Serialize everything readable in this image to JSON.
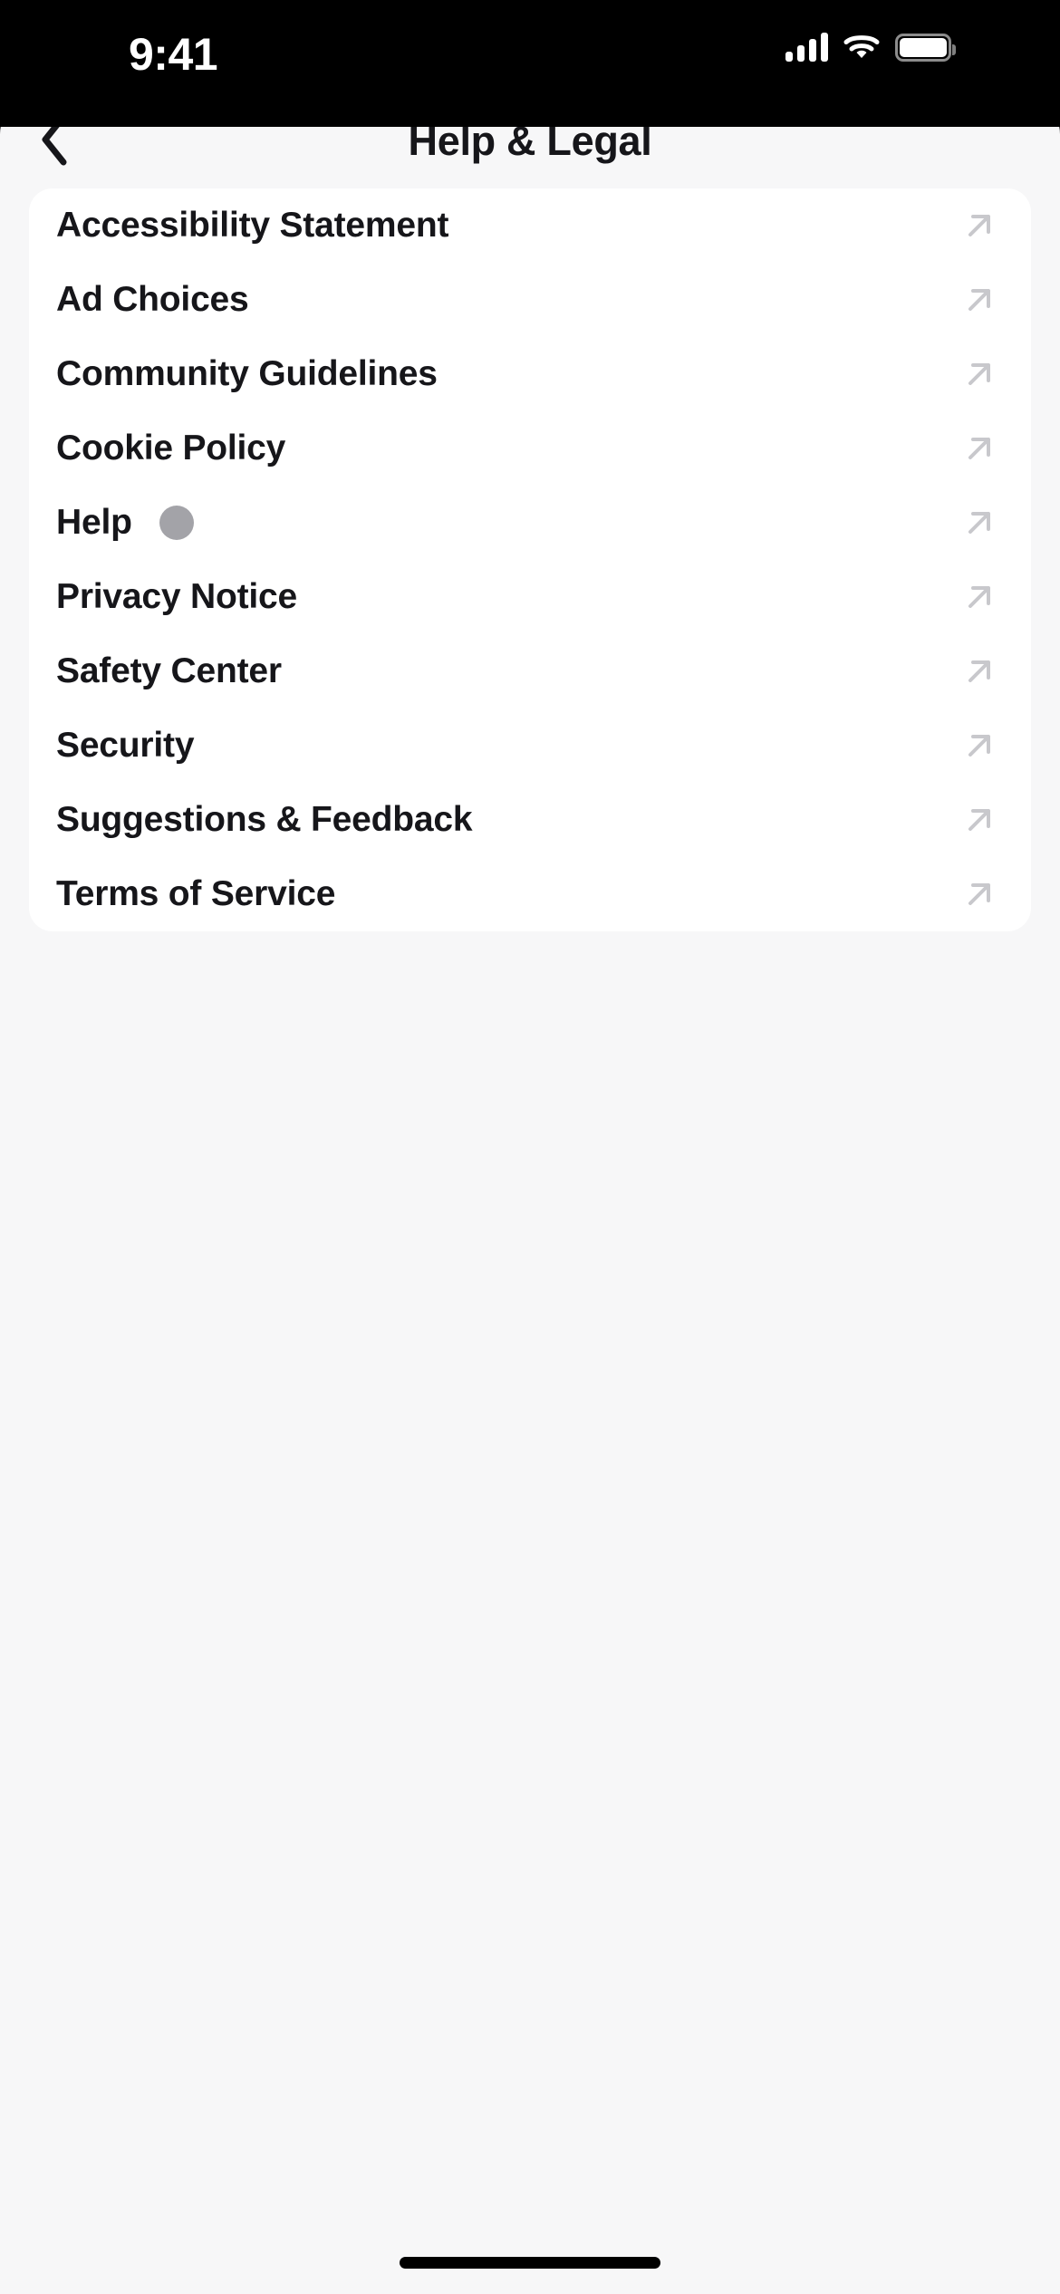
{
  "status_bar": {
    "time": "9:41",
    "cellular_icon": "cellular-signal-icon",
    "cellular_bars": 4,
    "wifi_icon": "wifi-icon",
    "battery_icon": "battery-icon",
    "battery_level_percent": 100
  },
  "header": {
    "back_icon": "chevron-left-icon",
    "title": "Help & Legal"
  },
  "list": {
    "items": [
      {
        "label": "Accessibility Statement",
        "icon": "external-link-icon",
        "badge": false
      },
      {
        "label": "Ad Choices",
        "icon": "external-link-icon",
        "badge": false
      },
      {
        "label": "Community Guidelines",
        "icon": "external-link-icon",
        "badge": false
      },
      {
        "label": "Cookie Policy",
        "icon": "external-link-icon",
        "badge": false
      },
      {
        "label": "Help",
        "icon": "external-link-icon",
        "badge": true
      },
      {
        "label": "Privacy Notice",
        "icon": "external-link-icon",
        "badge": false
      },
      {
        "label": "Safety Center",
        "icon": "external-link-icon",
        "badge": false
      },
      {
        "label": "Security",
        "icon": "external-link-icon",
        "badge": false
      },
      {
        "label": "Suggestions & Feedback",
        "icon": "external-link-icon",
        "badge": false
      },
      {
        "label": "Terms of Service",
        "icon": "external-link-icon",
        "badge": false
      }
    ]
  },
  "home_indicator": {
    "name": "home-indicator"
  },
  "colors": {
    "screen_background": "#000000",
    "sheet_background": "#f7f7f8",
    "sheet_behind": "#d4d4d8",
    "card_background": "#ffffff",
    "text_primary": "#16161a",
    "icon_muted": "#c8c8cc",
    "badge_gray": "#a3a3a8"
  }
}
